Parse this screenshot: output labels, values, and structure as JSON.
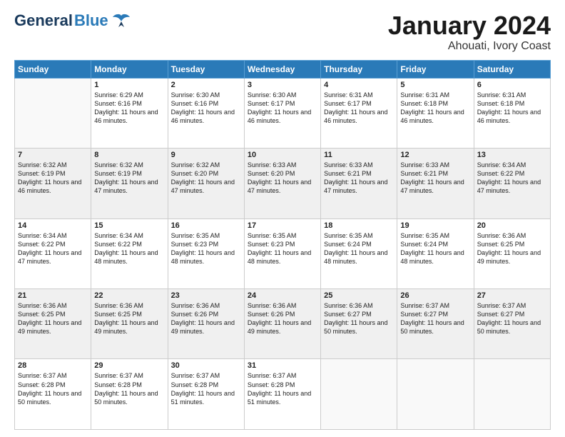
{
  "header": {
    "logo_general": "General",
    "logo_blue": "Blue",
    "month": "January 2024",
    "location": "Ahouati, Ivory Coast"
  },
  "days_of_week": [
    "Sunday",
    "Monday",
    "Tuesday",
    "Wednesday",
    "Thursday",
    "Friday",
    "Saturday"
  ],
  "weeks": [
    [
      {
        "day": "",
        "sunrise": "",
        "sunset": "",
        "daylight": ""
      },
      {
        "day": "1",
        "sunrise": "Sunrise: 6:29 AM",
        "sunset": "Sunset: 6:16 PM",
        "daylight": "Daylight: 11 hours and 46 minutes."
      },
      {
        "day": "2",
        "sunrise": "Sunrise: 6:30 AM",
        "sunset": "Sunset: 6:16 PM",
        "daylight": "Daylight: 11 hours and 46 minutes."
      },
      {
        "day": "3",
        "sunrise": "Sunrise: 6:30 AM",
        "sunset": "Sunset: 6:17 PM",
        "daylight": "Daylight: 11 hours and 46 minutes."
      },
      {
        "day": "4",
        "sunrise": "Sunrise: 6:31 AM",
        "sunset": "Sunset: 6:17 PM",
        "daylight": "Daylight: 11 hours and 46 minutes."
      },
      {
        "day": "5",
        "sunrise": "Sunrise: 6:31 AM",
        "sunset": "Sunset: 6:18 PM",
        "daylight": "Daylight: 11 hours and 46 minutes."
      },
      {
        "day": "6",
        "sunrise": "Sunrise: 6:31 AM",
        "sunset": "Sunset: 6:18 PM",
        "daylight": "Daylight: 11 hours and 46 minutes."
      }
    ],
    [
      {
        "day": "7",
        "sunrise": "Sunrise: 6:32 AM",
        "sunset": "Sunset: 6:19 PM",
        "daylight": "Daylight: 11 hours and 46 minutes."
      },
      {
        "day": "8",
        "sunrise": "Sunrise: 6:32 AM",
        "sunset": "Sunset: 6:19 PM",
        "daylight": "Daylight: 11 hours and 47 minutes."
      },
      {
        "day": "9",
        "sunrise": "Sunrise: 6:32 AM",
        "sunset": "Sunset: 6:20 PM",
        "daylight": "Daylight: 11 hours and 47 minutes."
      },
      {
        "day": "10",
        "sunrise": "Sunrise: 6:33 AM",
        "sunset": "Sunset: 6:20 PM",
        "daylight": "Daylight: 11 hours and 47 minutes."
      },
      {
        "day": "11",
        "sunrise": "Sunrise: 6:33 AM",
        "sunset": "Sunset: 6:21 PM",
        "daylight": "Daylight: 11 hours and 47 minutes."
      },
      {
        "day": "12",
        "sunrise": "Sunrise: 6:33 AM",
        "sunset": "Sunset: 6:21 PM",
        "daylight": "Daylight: 11 hours and 47 minutes."
      },
      {
        "day": "13",
        "sunrise": "Sunrise: 6:34 AM",
        "sunset": "Sunset: 6:22 PM",
        "daylight": "Daylight: 11 hours and 47 minutes."
      }
    ],
    [
      {
        "day": "14",
        "sunrise": "Sunrise: 6:34 AM",
        "sunset": "Sunset: 6:22 PM",
        "daylight": "Daylight: 11 hours and 47 minutes."
      },
      {
        "day": "15",
        "sunrise": "Sunrise: 6:34 AM",
        "sunset": "Sunset: 6:22 PM",
        "daylight": "Daylight: 11 hours and 48 minutes."
      },
      {
        "day": "16",
        "sunrise": "Sunrise: 6:35 AM",
        "sunset": "Sunset: 6:23 PM",
        "daylight": "Daylight: 11 hours and 48 minutes."
      },
      {
        "day": "17",
        "sunrise": "Sunrise: 6:35 AM",
        "sunset": "Sunset: 6:23 PM",
        "daylight": "Daylight: 11 hours and 48 minutes."
      },
      {
        "day": "18",
        "sunrise": "Sunrise: 6:35 AM",
        "sunset": "Sunset: 6:24 PM",
        "daylight": "Daylight: 11 hours and 48 minutes."
      },
      {
        "day": "19",
        "sunrise": "Sunrise: 6:35 AM",
        "sunset": "Sunset: 6:24 PM",
        "daylight": "Daylight: 11 hours and 48 minutes."
      },
      {
        "day": "20",
        "sunrise": "Sunrise: 6:36 AM",
        "sunset": "Sunset: 6:25 PM",
        "daylight": "Daylight: 11 hours and 49 minutes."
      }
    ],
    [
      {
        "day": "21",
        "sunrise": "Sunrise: 6:36 AM",
        "sunset": "Sunset: 6:25 PM",
        "daylight": "Daylight: 11 hours and 49 minutes."
      },
      {
        "day": "22",
        "sunrise": "Sunrise: 6:36 AM",
        "sunset": "Sunset: 6:25 PM",
        "daylight": "Daylight: 11 hours and 49 minutes."
      },
      {
        "day": "23",
        "sunrise": "Sunrise: 6:36 AM",
        "sunset": "Sunset: 6:26 PM",
        "daylight": "Daylight: 11 hours and 49 minutes."
      },
      {
        "day": "24",
        "sunrise": "Sunrise: 6:36 AM",
        "sunset": "Sunset: 6:26 PM",
        "daylight": "Daylight: 11 hours and 49 minutes."
      },
      {
        "day": "25",
        "sunrise": "Sunrise: 6:36 AM",
        "sunset": "Sunset: 6:27 PM",
        "daylight": "Daylight: 11 hours and 50 minutes."
      },
      {
        "day": "26",
        "sunrise": "Sunrise: 6:37 AM",
        "sunset": "Sunset: 6:27 PM",
        "daylight": "Daylight: 11 hours and 50 minutes."
      },
      {
        "day": "27",
        "sunrise": "Sunrise: 6:37 AM",
        "sunset": "Sunset: 6:27 PM",
        "daylight": "Daylight: 11 hours and 50 minutes."
      }
    ],
    [
      {
        "day": "28",
        "sunrise": "Sunrise: 6:37 AM",
        "sunset": "Sunset: 6:28 PM",
        "daylight": "Daylight: 11 hours and 50 minutes."
      },
      {
        "day": "29",
        "sunrise": "Sunrise: 6:37 AM",
        "sunset": "Sunset: 6:28 PM",
        "daylight": "Daylight: 11 hours and 50 minutes."
      },
      {
        "day": "30",
        "sunrise": "Sunrise: 6:37 AM",
        "sunset": "Sunset: 6:28 PM",
        "daylight": "Daylight: 11 hours and 51 minutes."
      },
      {
        "day": "31",
        "sunrise": "Sunrise: 6:37 AM",
        "sunset": "Sunset: 6:28 PM",
        "daylight": "Daylight: 11 hours and 51 minutes."
      },
      {
        "day": "",
        "sunrise": "",
        "sunset": "",
        "daylight": ""
      },
      {
        "day": "",
        "sunrise": "",
        "sunset": "",
        "daylight": ""
      },
      {
        "day": "",
        "sunrise": "",
        "sunset": "",
        "daylight": ""
      }
    ]
  ]
}
